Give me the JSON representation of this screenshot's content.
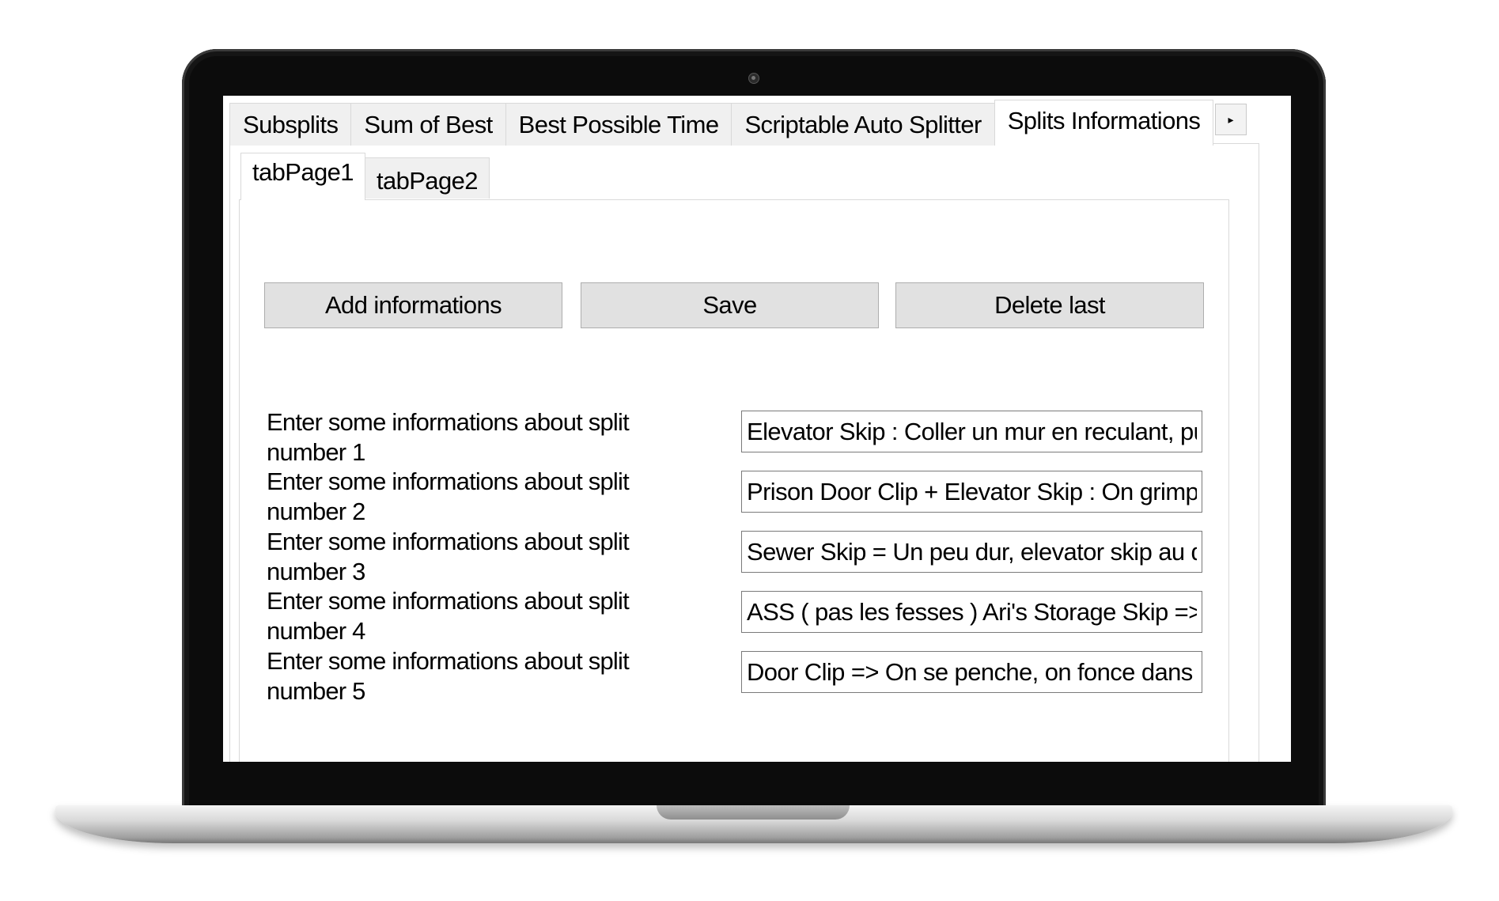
{
  "top_tabs": [
    {
      "label": "Subsplits"
    },
    {
      "label": "Sum of Best"
    },
    {
      "label": "Best Possible Time"
    },
    {
      "label": "Scriptable Auto Splitter"
    },
    {
      "label": "Splits Informations",
      "active": true
    }
  ],
  "tab_scroll": {
    "left_icon": "◂",
    "right_icon": "▸"
  },
  "sub_tabs": [
    {
      "label": "tabPage1",
      "active": true
    },
    {
      "label": "tabPage2"
    }
  ],
  "buttons": {
    "add": "Add informations",
    "save": "Save",
    "delete": "Delete last"
  },
  "rows": [
    {
      "label": "Enter some informations about split number 1",
      "value": "Elevator Skip : Coller un mur en reculant, pui"
    },
    {
      "label": "Enter some informations about split number 2",
      "value": "Prison Door Clip + Elevator Skip : On grimpe"
    },
    {
      "label": "Enter some informations about split number 3",
      "value": "Sewer Skip = Un peu dur, elevator skip au d"
    },
    {
      "label": "Enter some informations about split number 4",
      "value": "ASS ( pas les fesses ) Ari's Storage Skip => c"
    },
    {
      "label": "Enter some informations about split number 5",
      "value": "Door Clip => On se penche, on fonce dans le"
    }
  ]
}
